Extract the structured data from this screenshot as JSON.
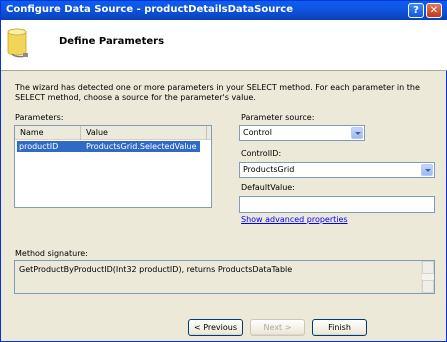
{
  "window": {
    "title": "Configure Data Source - productDetailsDataSource",
    "help_glyph": "?",
    "close_glyph": "✕"
  },
  "header": {
    "heading": "Define Parameters"
  },
  "description": "The wizard has detected one or more parameters in your SELECT method. For each parameter in the SELECT method, choose a source for the parameter's value.",
  "parameters": {
    "label": "Parameters:",
    "columns": [
      "Name",
      "Value"
    ],
    "rows": [
      {
        "name": "productID",
        "value": "ProductsGrid.SelectedValue"
      }
    ]
  },
  "parameter_source": {
    "label": "Parameter source:",
    "value": "Control"
  },
  "control_id": {
    "label": "ControlID:",
    "value": "ProductsGrid"
  },
  "default_value": {
    "label": "DefaultValue:",
    "value": ""
  },
  "advanced_link": "Show advanced properties",
  "method_signature": {
    "label": "Method signature:",
    "value": "GetProductByProductID(Int32 productID), returns ProductsDataTable"
  },
  "buttons": {
    "previous": "< Previous",
    "next": "Next >",
    "finish": "Finish"
  },
  "colors": {
    "titlebar": "#0a5ef2",
    "selection": "#316ac5",
    "link": "#0000ff"
  }
}
